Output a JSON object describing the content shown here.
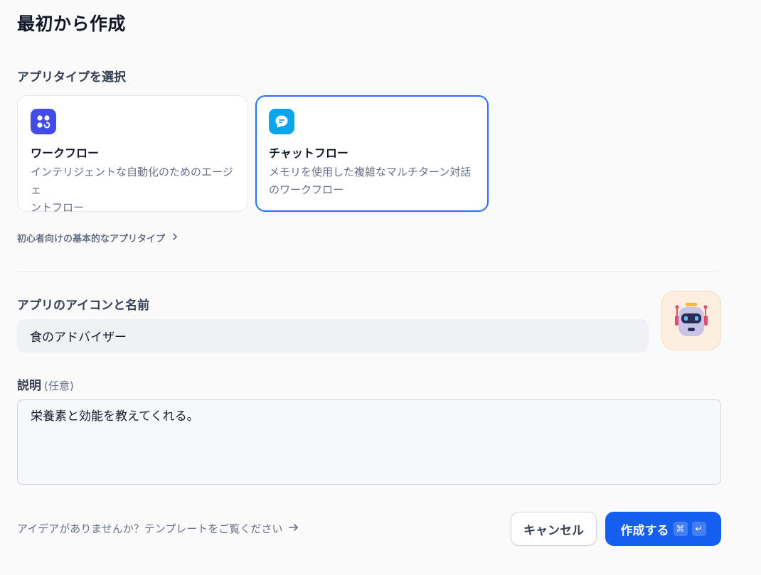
{
  "page": {
    "title": "最初から作成"
  },
  "app_type": {
    "label": "アプリタイプを選択",
    "options": [
      {
        "title": "ワークフロー",
        "desc_line1": "インテリジェントな自動化のためのエージェ",
        "desc_line2": "ントフロー",
        "icon": "workflow-icon",
        "selected": false
      },
      {
        "title": "チャットフロー",
        "desc_line1": "メモリを使用した複雑なマルチターン対話",
        "desc_line2": "のワークフロー",
        "icon": "chat-bubble-icon",
        "selected": true
      }
    ],
    "basic_link": "初心者向けの基本的なアプリタイプ"
  },
  "app_name": {
    "label": "アプリのアイコンと名前",
    "value": "食のアドバイザー",
    "icon": "robot-avatar-icon"
  },
  "description": {
    "label": "説明",
    "optional": "(任意)",
    "value": "栄養素と効能を教えてくれる。"
  },
  "footer": {
    "template_link": "アイデアがありませんか？テンプレートをご覧ください",
    "cancel_label": "キャンセル",
    "create_label": "作成する",
    "create_kbd_1": "⌘",
    "create_kbd_2": "↵"
  },
  "colors": {
    "primary": "#155eef",
    "selected_border": "#2970ff",
    "workflow_icon_bg": "#444ce7",
    "chatflow_icon_bg": "#0ba5ec"
  }
}
